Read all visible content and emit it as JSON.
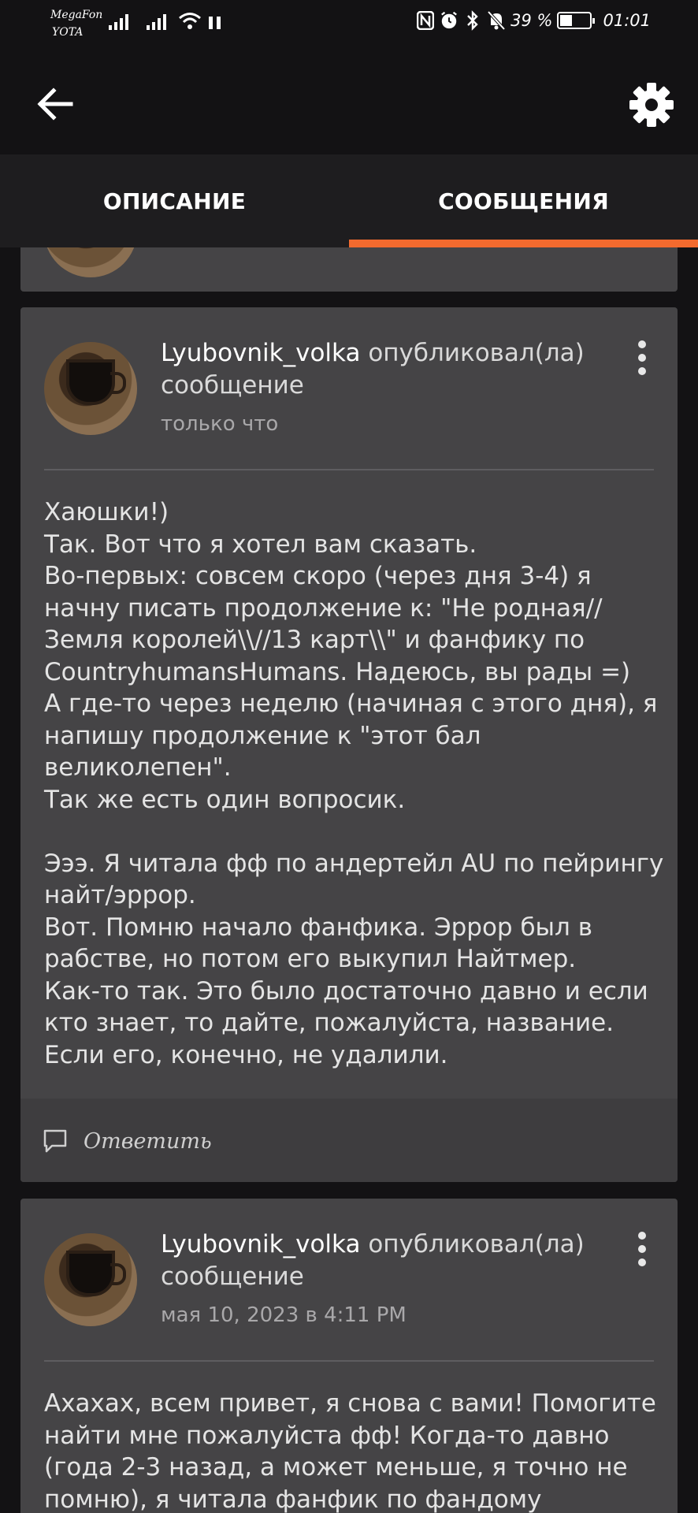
{
  "status": {
    "carrier1": "MegaFon",
    "carrier2": "YOTA",
    "battery_percent_text": "39 %",
    "battery_level": 0.39,
    "time": "01:01",
    "icons": [
      "signal-icon",
      "wifi-icon",
      "nfc-icon",
      "alarm-icon",
      "bluetooth-icon",
      "bell-off-icon",
      "battery-icon"
    ]
  },
  "appbar": {
    "back_icon": "arrow-left-icon",
    "settings_icon": "gear-icon"
  },
  "tabs": [
    {
      "label": "ОПИСАНИЕ",
      "active": false
    },
    {
      "label": "СООБЩЕНИЯ",
      "active": true
    }
  ],
  "colors": {
    "accent": "#f26a2e",
    "card": "#454446",
    "background": "#131214"
  },
  "messages": [
    {
      "author": "Lyubovnik_volka",
      "action": "опубликовал(ла) сообщение",
      "time": "только что",
      "text": "Хаюшки!)\nТак. Вот что я хотел вам сказать.\nВо-первых: совсем скоро (через дня 3-4) я начну писать продолжение к: \"Не родная// Земля королей\\\\//13 карт\\\\\" и фанфику по CountryhumansHumans. Надеюсь, вы рады =)\nА где-то через неделю (начиная с этого дня), я напишу продолжение к \"этот бал великолепен\".\nТак же есть один вопросик.\n\nЭээ. Я читала фф по андертейл AU по пейрингу найт/эррор.\nВот. Помню начало фанфика. Эррор был в рабстве, но потом его выкупил Найтмер.\nКак-то так. Это было достаточно давно и если кто знает, то дайте, пожалуйста, название.\nЕсли его, конечно, не удалили.",
      "reply_label": "Ответить"
    },
    {
      "author": "Lyubovnik_volka",
      "action": "опубликовал(ла) сообщение",
      "time": "мая 10, 2023 в 4:11 PM",
      "text": "Ахахах, всем привет, я снова с вами! Помогите найти мне пожалуйста фф! Когда-то давно (года 2-3 назад, а может меньше, я точно не помню), я читала фанфик по фандому"
    }
  ]
}
